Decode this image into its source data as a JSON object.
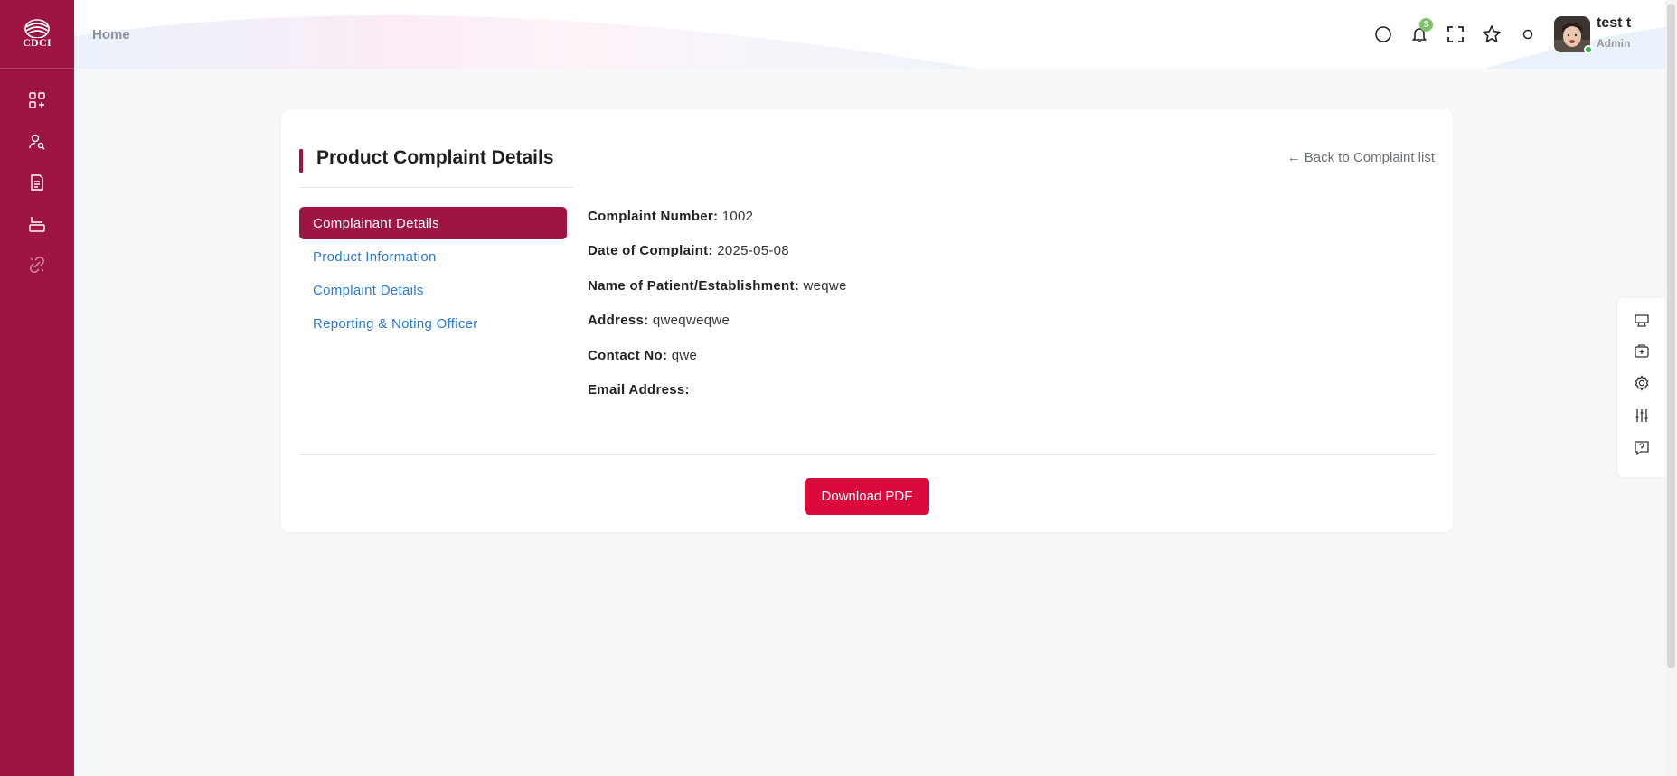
{
  "brand": {
    "logo_text": "CDCI"
  },
  "sidebar": {
    "items": [
      {
        "icon": "apps-grid-icon"
      },
      {
        "icon": "user-search-icon"
      },
      {
        "icon": "document-icon"
      },
      {
        "icon": "layout-icon"
      },
      {
        "icon": "link-broken-icon"
      }
    ]
  },
  "header": {
    "breadcrumb": "Home",
    "notification_count": "3",
    "user": {
      "name": "test t",
      "role": "Admin"
    }
  },
  "page": {
    "title": "Product Complaint Details",
    "back_link": "← Back to Complaint list",
    "tabs": [
      {
        "label": "Complainant Details",
        "active": true
      },
      {
        "label": "Product Information",
        "active": false
      },
      {
        "label": "Complaint Details",
        "active": false
      },
      {
        "label": "Reporting & Noting Officer",
        "active": false
      }
    ],
    "fields": [
      {
        "label": "Complaint Number:",
        "value": "1002"
      },
      {
        "label": "Date of Complaint:",
        "value": "2025-05-08"
      },
      {
        "label": "Name of Patient/Establishment:",
        "value": "weqwe"
      },
      {
        "label": "Address:",
        "value": "qweqweqwe"
      },
      {
        "label": "Contact No:",
        "value": "qwe"
      },
      {
        "label": "Email Address:",
        "value": ""
      }
    ],
    "download_button": "Download PDF"
  },
  "colors": {
    "brand": "#9e1442",
    "accent_button": "#dc0a3c",
    "link": "#2a7ad8",
    "badge": "#7cc36a"
  }
}
